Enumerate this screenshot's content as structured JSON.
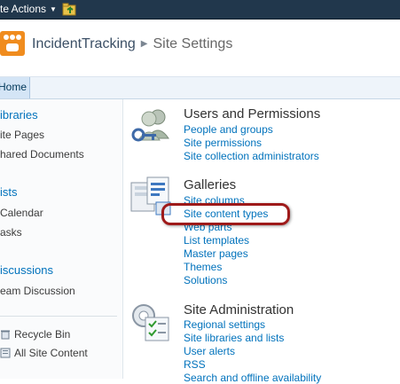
{
  "topbar": {
    "site_actions_label": "te Actions"
  },
  "header": {
    "site_name": "IncidentTracking",
    "current_page": "Site Settings"
  },
  "tabs": [
    {
      "label": "Home"
    }
  ],
  "leftnav": {
    "libraries_heading": "ibraries",
    "libraries": [
      "ite Pages",
      "hared Documents"
    ],
    "lists_heading": "ists",
    "lists": [
      "Calendar",
      "asks"
    ],
    "discussions_heading": "iscussions",
    "discussions": [
      "eam Discussion"
    ],
    "recycle_bin": "Recycle Bin",
    "all_site_content": "All Site Content"
  },
  "sections": [
    {
      "title": "Users and Permissions",
      "icon": "users-icon",
      "links": [
        "People and groups",
        "Site permissions",
        "Site collection administrators"
      ]
    },
    {
      "title": "Galleries",
      "icon": "galleries-icon",
      "links": [
        "Site columns",
        "Site content types",
        "Web parts",
        "List templates",
        "Master pages",
        "Themes",
        "Solutions"
      ]
    },
    {
      "title": "Site Administration",
      "icon": "site-administration-icon",
      "links": [
        "Regional settings",
        "Site libraries and lists",
        "User alerts",
        "RSS",
        "Search and offline availability"
      ]
    }
  ],
  "colors": {
    "topbar": "#21374c",
    "link": "#0072bc",
    "highlight": "#9e1a1a",
    "logo": "#f08c1e"
  }
}
